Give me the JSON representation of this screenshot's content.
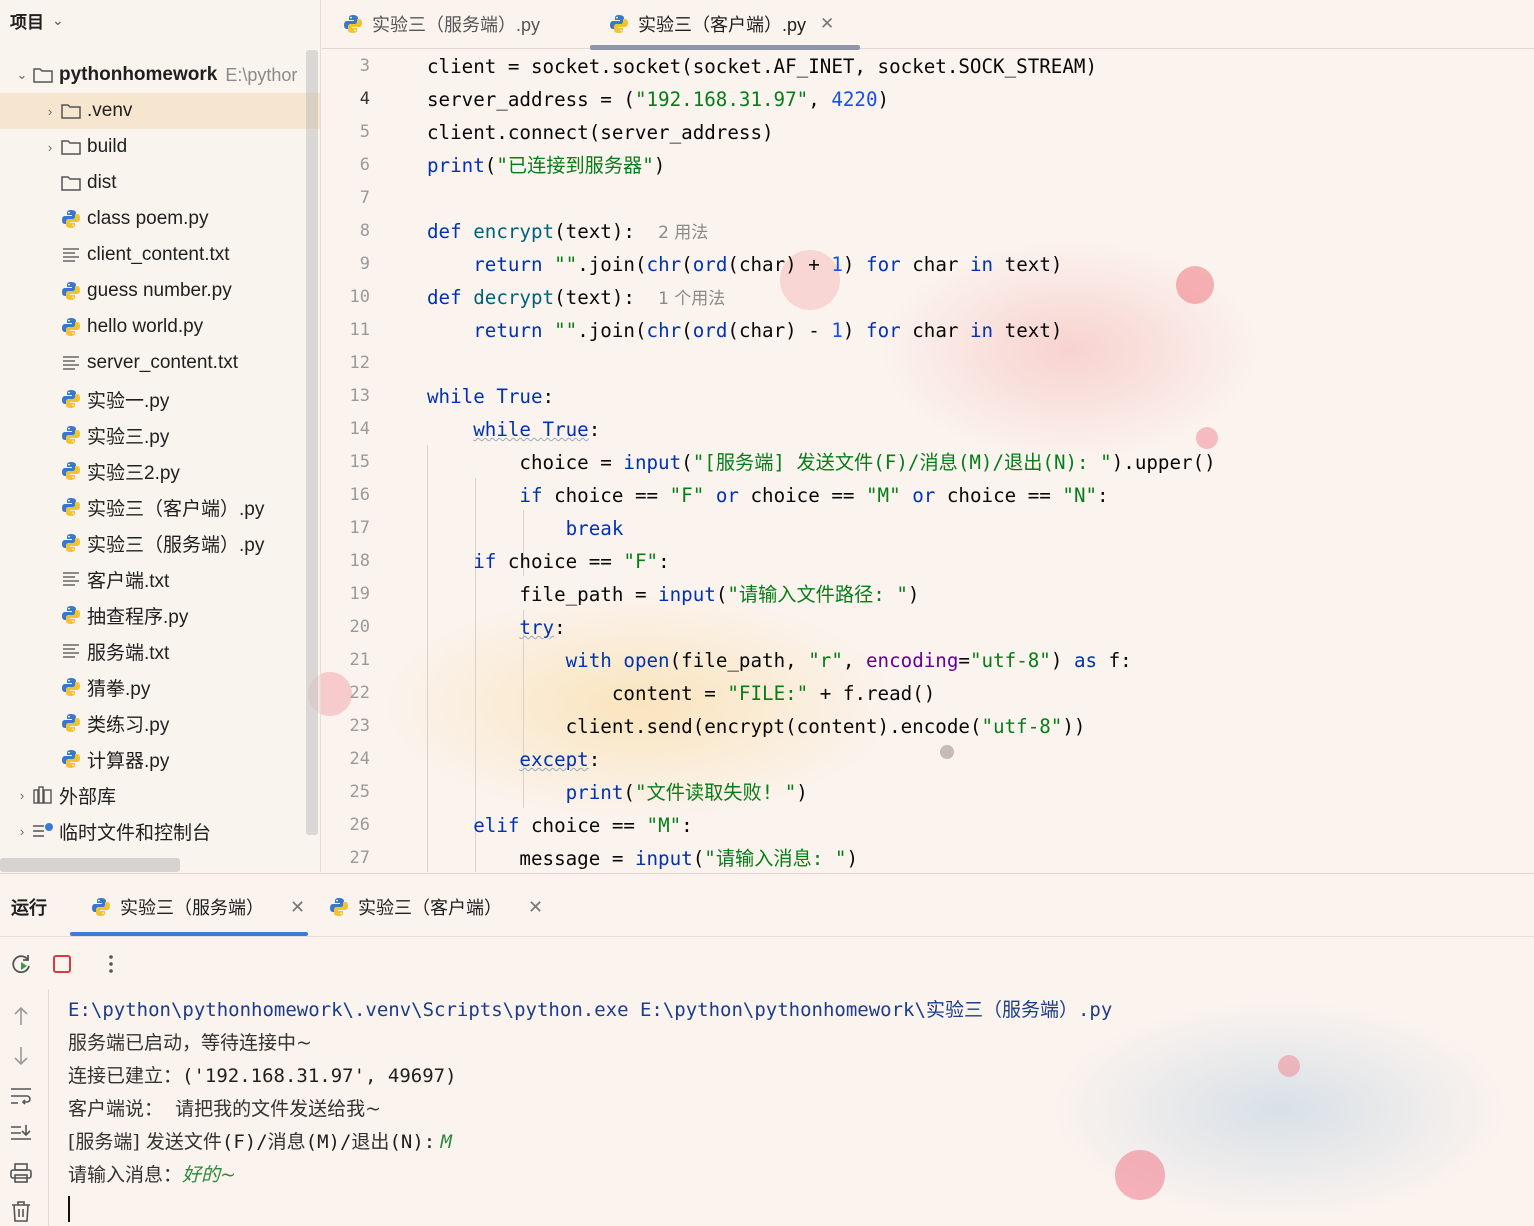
{
  "project_panel": {
    "title": "项目",
    "root": {
      "name": "pythonhomework",
      "path": "E:\\pythor"
    },
    "items": [
      {
        "label": "venv_display",
        "text": ".venv",
        "type": "folder",
        "collapsible": true
      },
      {
        "label": "build",
        "text": "build",
        "type": "folder",
        "collapsible": true
      },
      {
        "label": "dist",
        "text": "dist",
        "type": "folder",
        "collapsible": false
      },
      {
        "text": "class poem.py",
        "type": "python"
      },
      {
        "text": "client_content.txt",
        "type": "text"
      },
      {
        "text": "guess number.py",
        "type": "python"
      },
      {
        "text": "hello world.py",
        "type": "python"
      },
      {
        "text": "server_content.txt",
        "type": "text"
      },
      {
        "text": "实验一.py",
        "type": "python"
      },
      {
        "text": "实验三.py",
        "type": "python"
      },
      {
        "text": "实验三2.py",
        "type": "python"
      },
      {
        "text": "实验三（客户端）.py",
        "type": "python"
      },
      {
        "text": "实验三（服务端）.py",
        "type": "python"
      },
      {
        "text": "客户端.txt",
        "type": "text"
      },
      {
        "text": "抽查程序.py",
        "type": "python"
      },
      {
        "text": "服务端.txt",
        "type": "text"
      },
      {
        "text": "猜拳.py",
        "type": "python"
      },
      {
        "text": "类练习.py",
        "type": "python"
      },
      {
        "text": "计算器.py",
        "type": "python"
      }
    ],
    "external_libs": "外部库",
    "scratches": "临时文件和控制台"
  },
  "editor": {
    "tabs": [
      {
        "label": "实验三（服务端）.py",
        "active": false
      },
      {
        "label": "实验三（客户端）.py",
        "active": true
      }
    ],
    "close_glyph": "✕",
    "line_numbers": [
      "3",
      "4",
      "5",
      "6",
      "7",
      "8",
      "9",
      "10",
      "11",
      "12",
      "13",
      "14",
      "15",
      "16",
      "17",
      "18",
      "19",
      "20",
      "21",
      "22",
      "23",
      "24",
      "25",
      "26",
      "27"
    ],
    "hints": {
      "encrypt_usages": "2 用法",
      "decrypt_usages": "1 个用法"
    },
    "code": {
      "l3": "client = socket.socket(socket.AF_INET, socket.SOCK_STREAM)",
      "l4_a": "server_address = (",
      "l4_ip": "\"192.168.31.97\"",
      "l4_b": ", ",
      "l4_port": "4220",
      "l4_c": ")",
      "l5": "client.connect(server_address)",
      "l6_fn": "print",
      "l6_a": "(",
      "l6_str": "\"已连接到服务器\"",
      "l6_b": ")",
      "l8_kw": "def ",
      "l8_fn": "encrypt",
      "l8_a": "(text):",
      "l9_kw": "return ",
      "l9_str": "\"\"",
      "l9_a": ".join(",
      "l9_b": "chr",
      "l9_c": "(",
      "l9_d": "ord",
      "l9_e": "(char) + ",
      "l9_num": "1",
      "l9_f": ") ",
      "l9_for": "for",
      "l9_g": " char ",
      "l9_in": "in",
      "l9_h": " text)",
      "l10_kw": "def ",
      "l10_fn": "decrypt",
      "l10_a": "(text):",
      "l11_kw": "return ",
      "l11_str": "\"\"",
      "l11_a": ".join(",
      "l11_b": "chr",
      "l11_c": "(",
      "l11_d": "ord",
      "l11_e": "(char) - ",
      "l11_num": "1",
      "l11_f": ") ",
      "l11_for": "for",
      "l11_g": " char ",
      "l11_in": "in",
      "l11_h": " text)",
      "l13_kw": "while ",
      "l13_true": "True",
      "l13_a": ":",
      "l14_kw": "while ",
      "l14_true": "True",
      "l14_a": ":",
      "l15_a": "choice = ",
      "l15_fn": "input",
      "l15_b": "(",
      "l15_str": "\"[服务端] 发送文件(F)/消息(M)/退出(N): \"",
      "l15_c": ").upper()",
      "l16_kw": "if",
      "l16_a": " choice == ",
      "l16_s1": "\"F\"",
      "l16_or1": " or",
      "l16_b": " choice == ",
      "l16_s2": "\"M\"",
      "l16_or2": " or",
      "l16_c": " choice == ",
      "l16_s3": "\"N\"",
      "l16_d": ":",
      "l17_kw": "break",
      "l18_kw": "if",
      "l18_a": " choice == ",
      "l18_str": "\"F\"",
      "l18_b": ":",
      "l19_a": "file_path = ",
      "l19_fn": "input",
      "l19_b": "(",
      "l19_str": "\"请输入文件路径: \"",
      "l19_c": ")",
      "l20_kw": "try",
      "l20_a": ":",
      "l21_kw": "with ",
      "l21_fn": "open",
      "l21_a": "(file_path, ",
      "l21_s1": "\"r\"",
      "l21_b": ", ",
      "l21_enc": "encoding",
      "l21_c": "=",
      "l21_s2": "\"utf-8\"",
      "l21_d": ") ",
      "l21_as": "as",
      "l21_e": " f:",
      "l22_a": "content = ",
      "l22_str": "\"FILE:\"",
      "l22_b": " + f.read()",
      "l23_a": "client.send(encrypt(content).encode(",
      "l23_str": "\"utf-8\"",
      "l23_b": "))",
      "l24_kw": "except",
      "l24_a": ":",
      "l25_fn": "print",
      "l25_a": "(",
      "l25_str": "\"文件读取失败! \"",
      "l25_b": ")",
      "l26_kw": "elif",
      "l26_a": " choice == ",
      "l26_str": "\"M\"",
      "l26_b": ":",
      "l27_a": "message = ",
      "l27_fn": "input",
      "l27_b": "(",
      "l27_str": "\"请输入消息: \"",
      "l27_c": ")"
    }
  },
  "run_panel": {
    "title": "运行",
    "tabs": [
      {
        "label": "实验三（服务端）",
        "active": true
      },
      {
        "label": "实验三（客户端）",
        "active": false
      }
    ],
    "console": {
      "cmd_path": "E:\\python\\pythonhomework\\.venv\\Scripts\\python.exe E:\\python\\pythonhomework\\",
      "cmd_script": "实验三（服务端）",
      "cmd_ext": ".py",
      "line2": "服务端已启动，等待连接中~",
      "line3_zh": "连接已建立：",
      "line3_val": "('192.168.31.97', 49697)",
      "line4": "客户端说：  请把我的文件发送给我~",
      "line5_prompt_zh": "[服务端] 发送文件",
      "line5_mono": "(F)/",
      "line5_zh2": "消息",
      "line5_mono2": "(M)/",
      "line5_zh3": "退出",
      "line5_mono3": "(N):",
      "line5_input": "M",
      "line6_prompt": "请输入消息：",
      "line6_input": "好的~"
    }
  },
  "colors": {
    "keyword": "#0033b3",
    "string": "#067d17",
    "number": "#1750eb",
    "accent_tab": "#3d79d6",
    "user_input": "#2a8a3a"
  }
}
